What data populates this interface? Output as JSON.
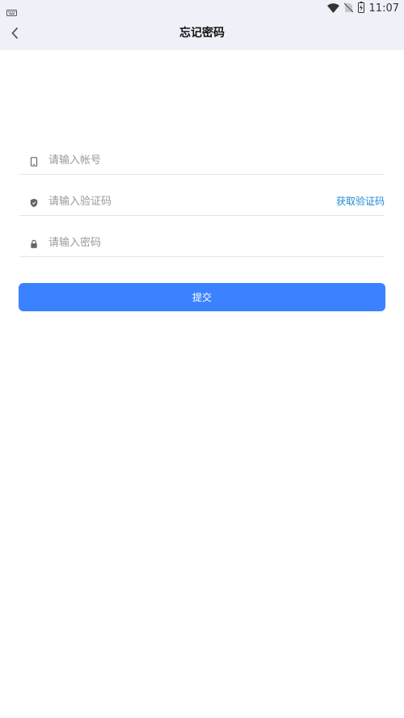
{
  "status_bar": {
    "time": "11:07",
    "icons": [
      "keyboard-icon",
      "wifi-icon",
      "no-sim-icon",
      "battery-charging-icon"
    ]
  },
  "header": {
    "back_icon": "chevron-left-icon",
    "title": "忘记密码"
  },
  "form": {
    "account": {
      "icon": "phone-icon",
      "placeholder": "请输入帐号",
      "value": ""
    },
    "code": {
      "icon": "shield-icon",
      "placeholder": "请输入验证码",
      "value": "",
      "get_code_label": "获取验证码"
    },
    "password": {
      "icon": "lock-icon",
      "placeholder": "请输入密码",
      "value": ""
    },
    "submit_label": "提交"
  },
  "colors": {
    "primary": "#3a82ff",
    "link": "#1f8ad6",
    "header_bg": "#eef1f7"
  }
}
